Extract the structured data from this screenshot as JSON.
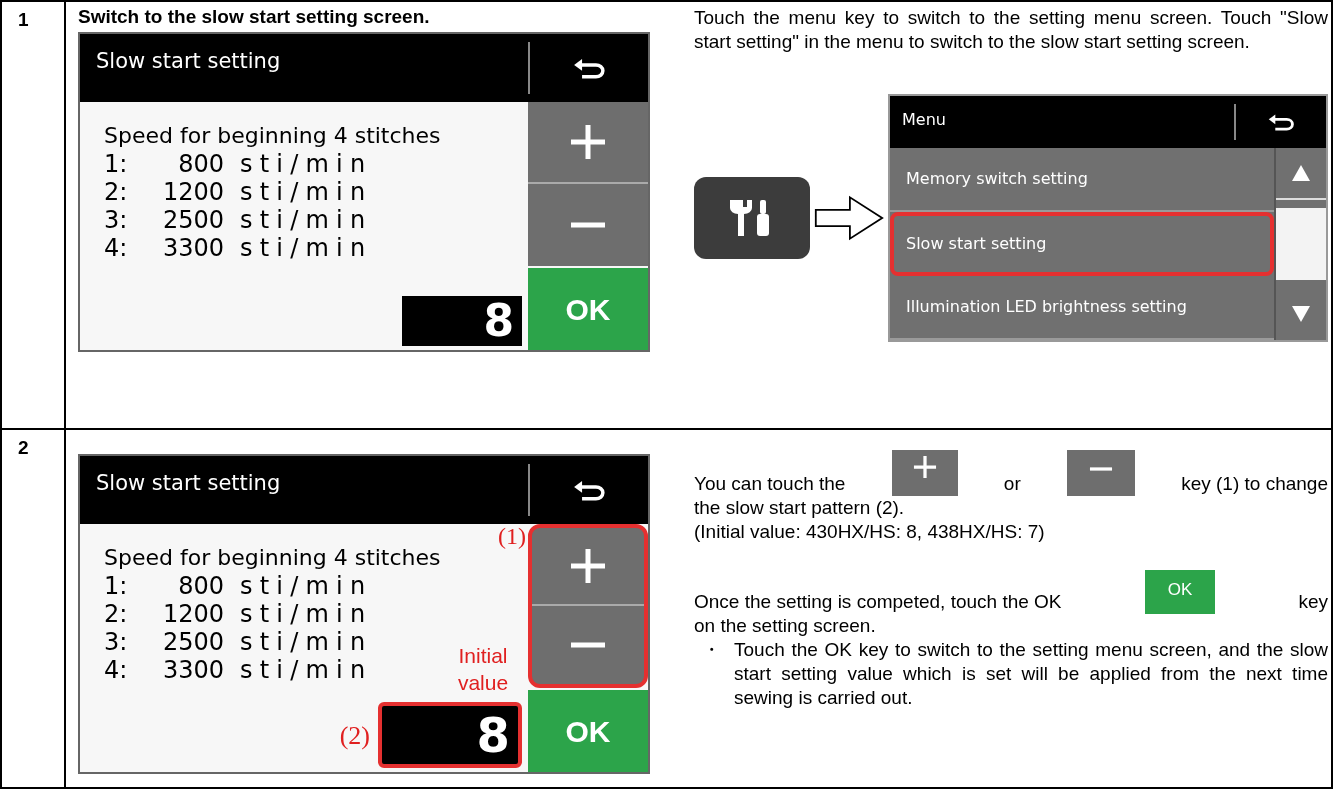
{
  "steps": [
    {
      "number": "1",
      "heading": "Switch to the slow start setting screen.",
      "screen": {
        "title": "Slow start setting",
        "heading": "Speed for beginning 4 stitches",
        "lines": [
          {
            "label": "1:",
            "speed": "800",
            "unit": "sti/min"
          },
          {
            "label": "2:",
            "speed": "1200",
            "unit": "sti/min"
          },
          {
            "label": "3:",
            "speed": "2500",
            "unit": "sti/min"
          },
          {
            "label": "4:",
            "speed": "3300",
            "unit": "sti/min"
          }
        ],
        "value": "8",
        "ok": "OK",
        "keys_marked": false,
        "value_marked": false
      },
      "paragraphs": [
        "Touch the menu key to switch to the setting menu screen. Touch \"Slow start setting\" in the menu to switch to the slow start setting screen."
      ],
      "menu": {
        "title": "Menu",
        "items": [
          {
            "label": "Memory switch setting",
            "selected": false
          },
          {
            "label": "Slow start setting",
            "selected": true
          },
          {
            "label": "Illumination LED brightness setting",
            "selected": false
          }
        ]
      }
    },
    {
      "number": "2",
      "screen": {
        "title": "Slow start setting",
        "heading": "Speed for beginning 4 stitches",
        "lines": [
          {
            "label": "1:",
            "speed": "800",
            "unit": "sti/min"
          },
          {
            "label": "2:",
            "speed": "1200",
            "unit": "sti/min"
          },
          {
            "label": "3:",
            "speed": "2500",
            "unit": "sti/min"
          },
          {
            "label": "4:",
            "speed": "3300",
            "unit": "sti/min"
          }
        ],
        "value": "8",
        "ok": "OK",
        "keys_marked": true,
        "value_marked": true
      },
      "callouts": {
        "keys": "(1)",
        "value": "(2)",
        "initial": "Initial value"
      },
      "description": [
        {
          "kind": "line",
          "parts": [
            {
              "kind": "text",
              "text": "You can touch the"
            },
            {
              "kind": "plus_key"
            },
            {
              "kind": "text",
              "text": "or"
            },
            {
              "kind": "minus_key"
            },
            {
              "kind": "text",
              "text": "key (1) to change"
            }
          ]
        },
        {
          "kind": "para",
          "parts": [
            {
              "kind": "text",
              "text": "the slow start pattern (2)."
            }
          ]
        },
        {
          "kind": "para",
          "parts": [
            {
              "kind": "text",
              "text": "(Initial value: 430HX/HS: 8, 438HX/HS: 7)"
            }
          ]
        },
        {
          "kind": "gap"
        },
        {
          "kind": "line",
          "parts": [
            {
              "kind": "text",
              "text": "Once the setting is competed, touch the OK"
            },
            {
              "kind": "ok_key",
              "text": "OK"
            },
            {
              "kind": "text",
              "text": "key"
            }
          ]
        },
        {
          "kind": "para",
          "parts": [
            {
              "kind": "text",
              "text": "on the setting screen."
            }
          ]
        },
        {
          "kind": "bullet",
          "mark": "・",
          "text": "Touch the OK key to switch to the setting menu screen, and the slow start setting value which is set will be applied from the next time sewing is carried out."
        }
      ]
    }
  ]
}
